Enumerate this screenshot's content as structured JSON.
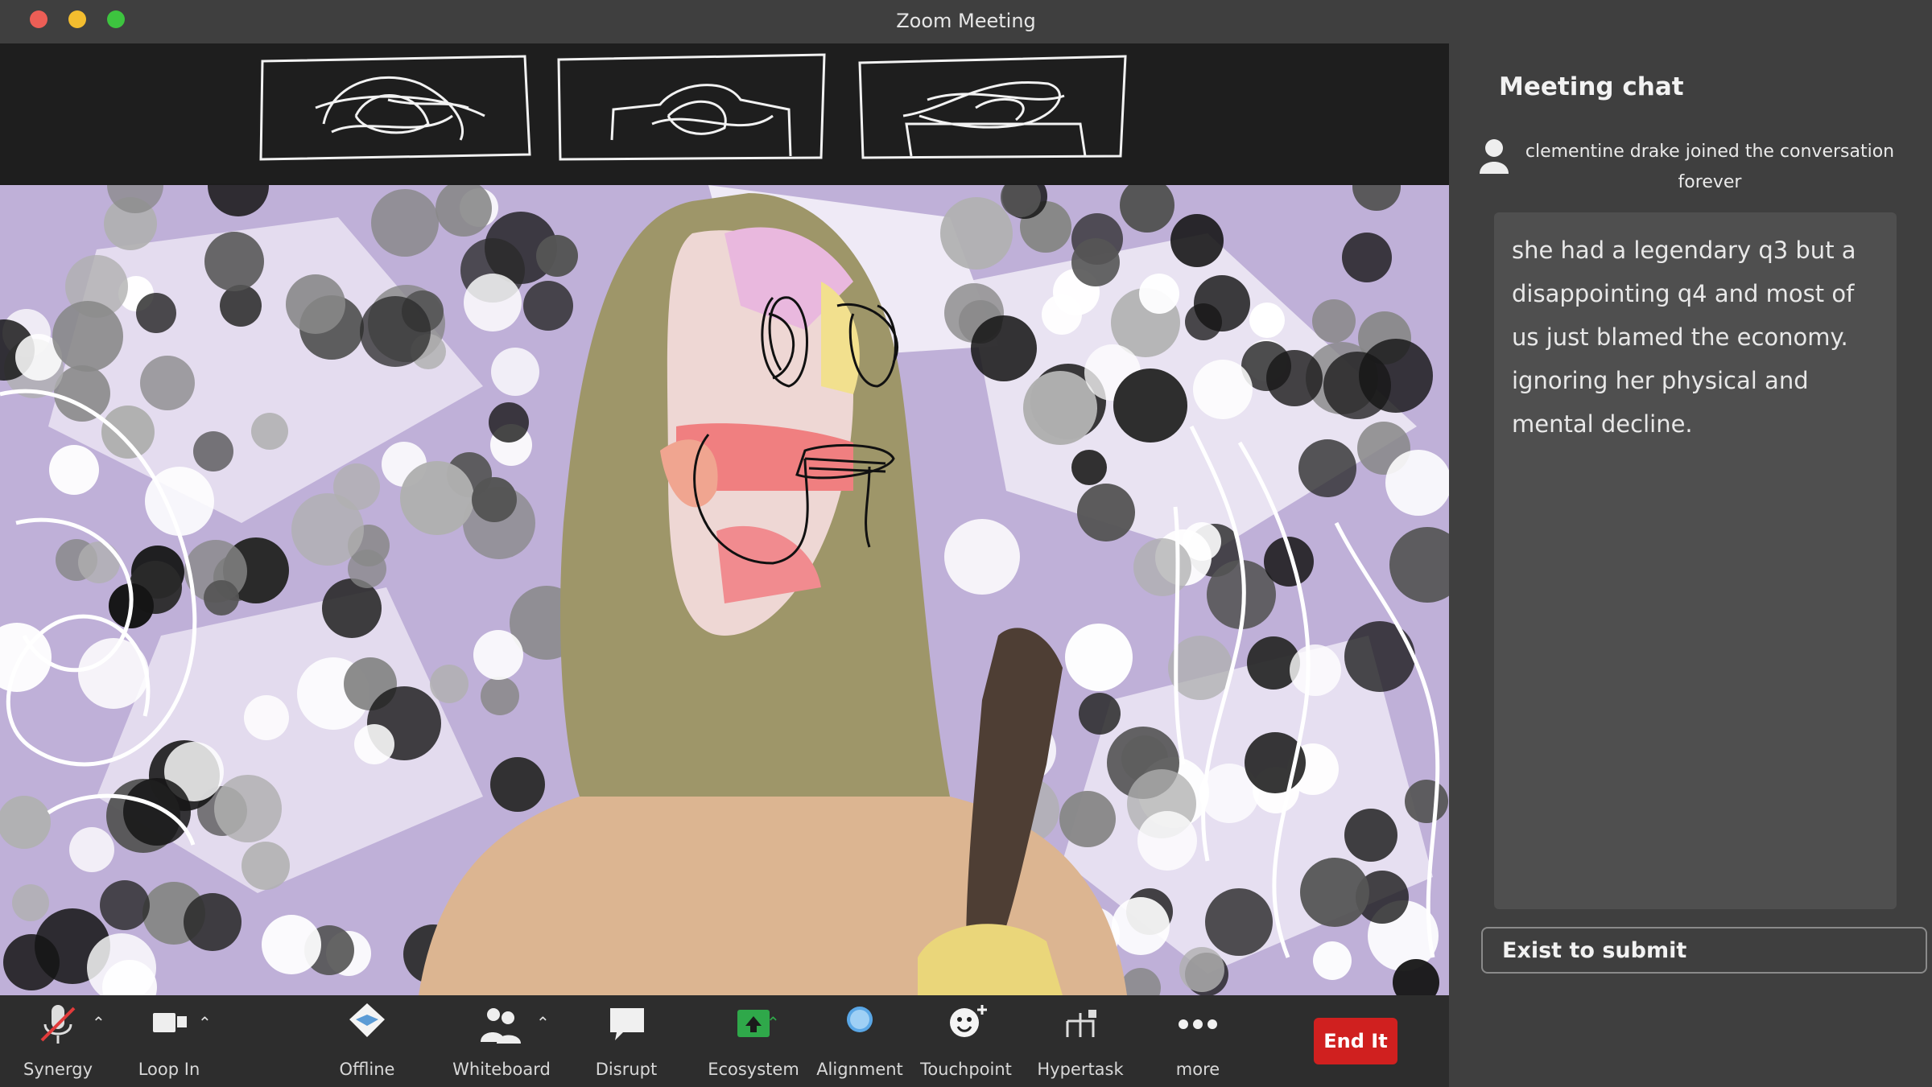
{
  "window": {
    "title": "Zoom Meeting"
  },
  "toolbar": {
    "items": [
      {
        "label": "Synergy",
        "icon": "microphone-muted-icon"
      },
      {
        "label": "Loop In",
        "icon": "video-camera-icon"
      },
      {
        "label": "Offline",
        "icon": "bowtie-icon"
      },
      {
        "label": "Whiteboard",
        "icon": "participants-icon"
      },
      {
        "label": "Disrupt",
        "icon": "chat-bubble-icon"
      },
      {
        "label": "Ecosystem",
        "icon": "share-screen-icon"
      },
      {
        "label": "Alignment",
        "icon": "record-icon"
      },
      {
        "label": "Touchpoint",
        "icon": "reactions-icon"
      },
      {
        "label": "Hypertask",
        "icon": "apps-icon"
      },
      {
        "label": "more",
        "icon": "more-dots-icon"
      }
    ],
    "end_label": "End It"
  },
  "chat": {
    "title": "Meeting chat",
    "join_notice": "clementine drake  joined the conversation forever",
    "message": "she had a legendary q3 but a disappointing q4 and most of us just blamed the economy. ignoring her physical and mental decline.",
    "input_placeholder": "Exist to submit"
  },
  "colors": {
    "titlebar": "#3f3f3f",
    "stage": "#1c1c1c",
    "toolbar": "#2d2d2d",
    "chat_bg": "#3f3f3f",
    "message_bg": "#4f4f4f",
    "end_button": "#d0201f",
    "ecosystem_icon": "#2fa84a",
    "alignment_icon": "#5aa7e6",
    "close": "#ec5e56",
    "minimize": "#f3bd2f",
    "maximize": "#3dc43f"
  }
}
